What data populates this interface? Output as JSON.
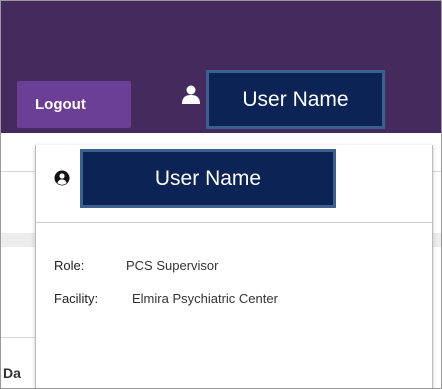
{
  "header": {
    "logout_label": "Logout",
    "user_name": "User Name"
  },
  "user_panel": {
    "user_name": "User Name",
    "role_label": "Role:",
    "role_value": "PCS Supervisor",
    "facility_label": "Facility:",
    "facility_value": "Elmira Psychiatric Center"
  },
  "background": {
    "partial_text": "Da"
  },
  "colors": {
    "header_bg": "#452a5e",
    "logout_bg": "#6b3f96",
    "name_box_bg": "#0c2356",
    "name_box_border": "#3b5f8e"
  },
  "icons": {
    "header_user": "user-icon",
    "panel_user": "user-circle-icon"
  }
}
